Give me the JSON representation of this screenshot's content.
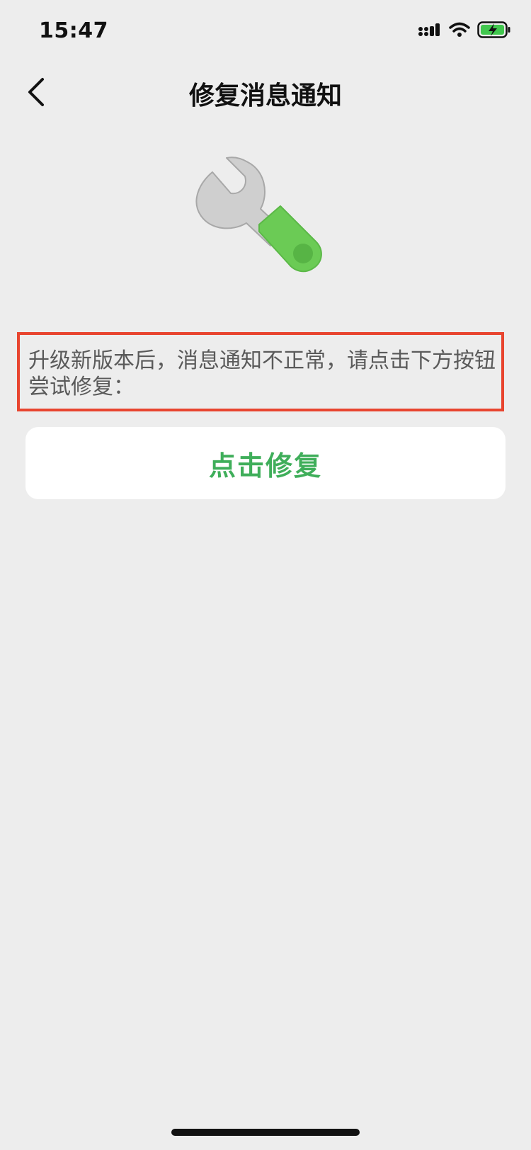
{
  "status_bar": {
    "time": "15:47",
    "icons": [
      "signal-icon",
      "wifi-icon",
      "battery-charging-icon"
    ]
  },
  "nav": {
    "back_icon": "chevron-left-icon",
    "title": "修复消息通知"
  },
  "illustration": {
    "icon": "wrench-icon",
    "colors": {
      "metal": "#CFCFCF",
      "metal_edge": "#9F9F9F",
      "handle": "#6BCB55",
      "handle_dot": "#57B445"
    }
  },
  "notice": {
    "text": "升级新版本后，消息通知不正常，请点击下方按钮尝试修复：",
    "highlight_color": "#E8452F"
  },
  "actions": {
    "repair_label": "点击修复",
    "accent": "#3FAE5A"
  }
}
